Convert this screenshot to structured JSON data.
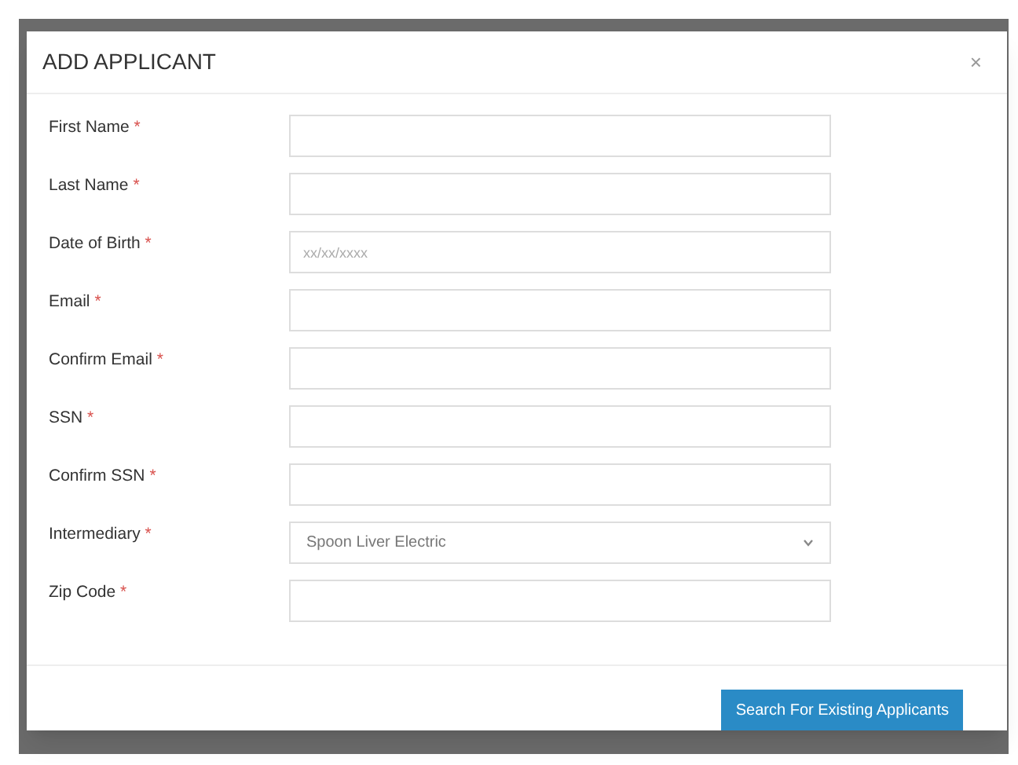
{
  "modal": {
    "title": "ADD APPLICANT",
    "close": "×",
    "fields": [
      {
        "label": "First Name",
        "required_mark": "*",
        "kind": "text"
      },
      {
        "label": "Last Name",
        "required_mark": "*",
        "kind": "text"
      },
      {
        "label": "Date of Birth",
        "required_mark": "*",
        "kind": "text",
        "placeholder": "xx/xx/xxxx"
      },
      {
        "label": "Email",
        "required_mark": "*",
        "kind": "text"
      },
      {
        "label": "Confirm Email",
        "required_mark": "*",
        "kind": "text"
      },
      {
        "label": "SSN",
        "required_mark": "*",
        "kind": "text"
      },
      {
        "label": "Confirm SSN",
        "required_mark": "*",
        "kind": "text"
      },
      {
        "label": "Intermediary",
        "required_mark": "*",
        "kind": "select",
        "value": "Spoon Liver Electric"
      },
      {
        "label": "Zip Code",
        "required_mark": "*",
        "kind": "text"
      }
    ],
    "button": "Search For Existing Applicants"
  }
}
